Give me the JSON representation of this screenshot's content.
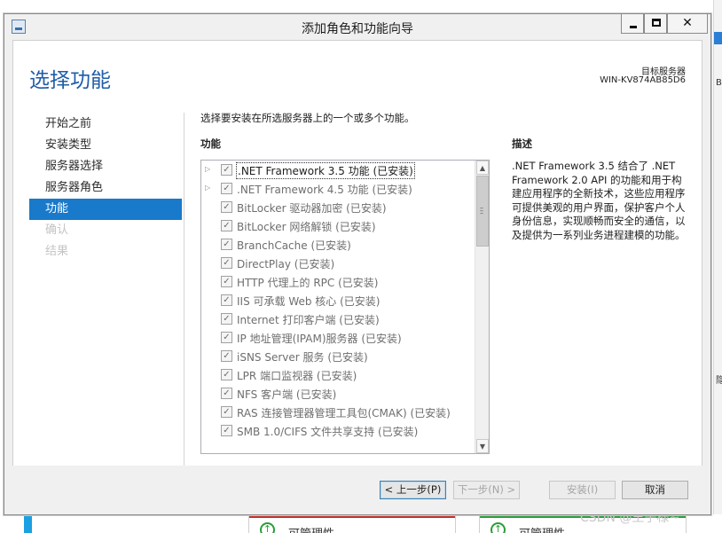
{
  "window": {
    "title": "添加角色和功能向导",
    "minimize_label": "",
    "maximize_label": "",
    "close_label": "✕"
  },
  "header": {
    "page_title": "选择功能",
    "target_label": "目标服务器",
    "target_server": "WIN-KV874AB85D6"
  },
  "nav": {
    "items": [
      {
        "label": "开始之前",
        "state": "normal"
      },
      {
        "label": "安装类型",
        "state": "normal"
      },
      {
        "label": "服务器选择",
        "state": "normal"
      },
      {
        "label": "服务器角色",
        "state": "normal"
      },
      {
        "label": "功能",
        "state": "active"
      },
      {
        "label": "确认",
        "state": "disabled"
      },
      {
        "label": "结果",
        "state": "disabled"
      }
    ]
  },
  "main": {
    "instruction": "选择要安装在所选服务器上的一个或多个功能。",
    "features_heading": "功能",
    "features": [
      {
        "label": ".NET Framework 3.5 功能 (已安装)",
        "expandable": true,
        "checked": true,
        "selected": true
      },
      {
        "label": ".NET Framework 4.5 功能 (已安装)",
        "expandable": true,
        "checked": true,
        "selected": false
      },
      {
        "label": "BitLocker 驱动器加密 (已安装)",
        "expandable": false,
        "checked": true,
        "selected": false
      },
      {
        "label": "BitLocker 网络解锁 (已安装)",
        "expandable": false,
        "checked": true,
        "selected": false
      },
      {
        "label": "BranchCache (已安装)",
        "expandable": false,
        "checked": true,
        "selected": false
      },
      {
        "label": "DirectPlay (已安装)",
        "expandable": false,
        "checked": true,
        "selected": false
      },
      {
        "label": "HTTP 代理上的 RPC (已安装)",
        "expandable": false,
        "checked": true,
        "selected": false
      },
      {
        "label": "IIS 可承载 Web 核心 (已安装)",
        "expandable": false,
        "checked": true,
        "selected": false
      },
      {
        "label": "Internet 打印客户端 (已安装)",
        "expandable": false,
        "checked": true,
        "selected": false
      },
      {
        "label": "IP 地址管理(IPAM)服务器 (已安装)",
        "expandable": false,
        "checked": true,
        "selected": false
      },
      {
        "label": "iSNS Server 服务 (已安装)",
        "expandable": false,
        "checked": true,
        "selected": false
      },
      {
        "label": "LPR 端口监视器 (已安装)",
        "expandable": false,
        "checked": true,
        "selected": false
      },
      {
        "label": "NFS 客户端 (已安装)",
        "expandable": false,
        "checked": true,
        "selected": false
      },
      {
        "label": "RAS 连接管理器管理工具包(CMAK) (已安装)",
        "expandable": false,
        "checked": true,
        "selected": false
      },
      {
        "label": "SMB 1.0/CIFS 文件共享支持 (已安装)",
        "expandable": false,
        "checked": true,
        "selected": false
      },
      {
        "label": "",
        "expandable": false,
        "checked": false,
        "selected": false
      }
    ],
    "description_heading": "描述",
    "description_text": ".NET Framework 3.5 结合了 .NET Framework 2.0 API 的功能和用于构建应用程序的全新技术，这些应用程序可提供美观的用户界面，保护客户个人身份信息，实现顺畅而安全的通信，以及提供为一系列业务进程建模的功能。"
  },
  "footer": {
    "prev_label": "< 上一步(P)",
    "next_label": "下一步(N) >",
    "install_label": "安装(I)",
    "cancel_label": "取消"
  },
  "background": {
    "card_left_label": "可管理性",
    "card_right_label": "可管理性",
    "right_fragment_1": "B)",
    "right_fragment_2": "隐",
    "watermark": "CSDN @王子様~"
  },
  "colors": {
    "accent": "#1979ca",
    "title_blue": "#1f5da8",
    "card_left_top": "#c0302b",
    "card_right_top": "#2a9d3a"
  },
  "icons": {
    "app": "server-manager-icon",
    "expander": "triangle-right-icon",
    "checkbox": "checkmark-icon"
  }
}
